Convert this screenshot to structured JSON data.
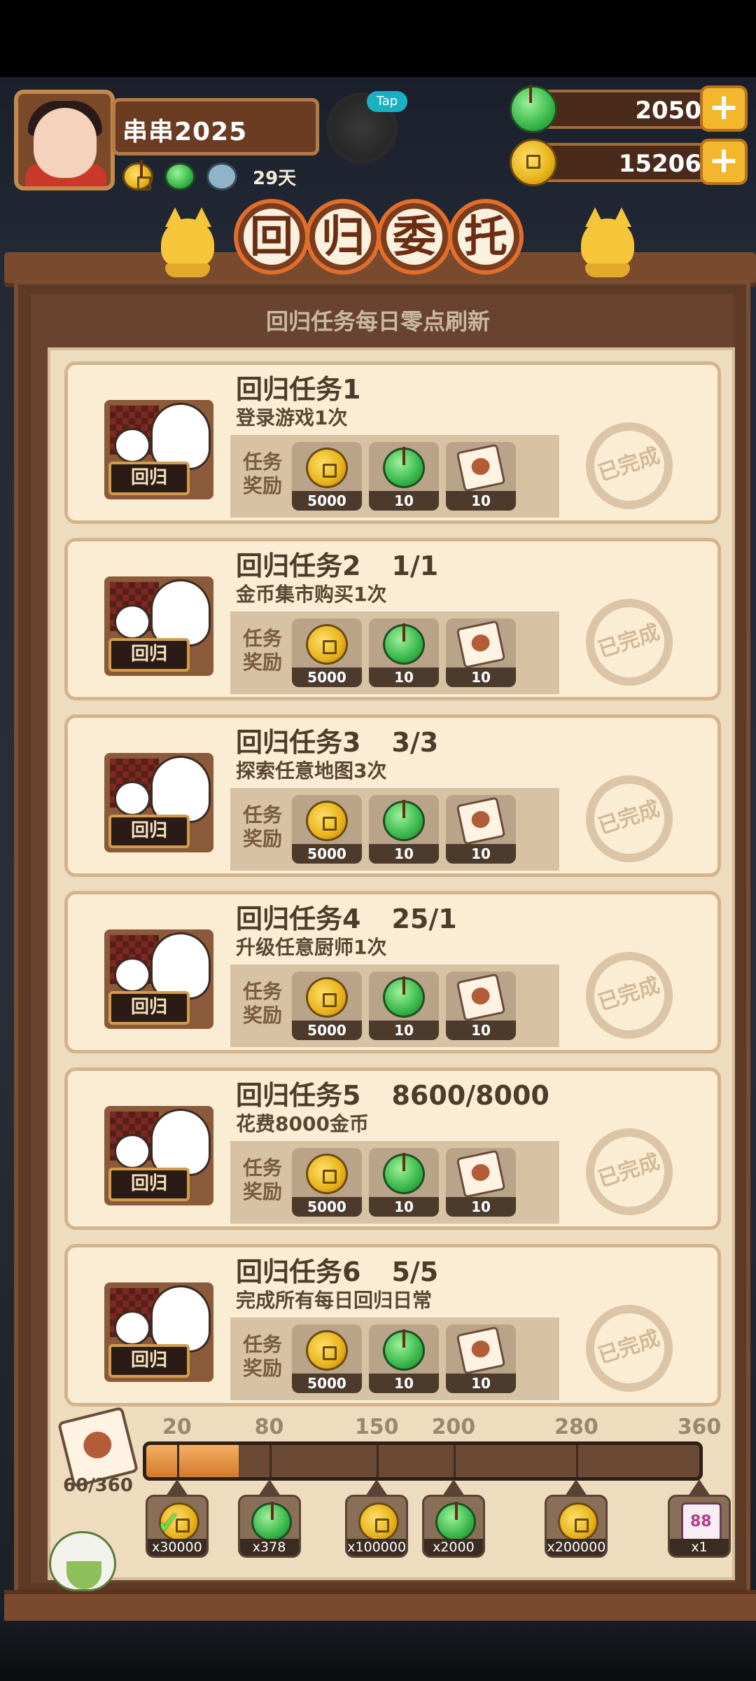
{
  "player": {
    "name": "串串2025",
    "days": "29天",
    "bonus_icons": [
      "coin-boost-icon",
      "jade-boost-icon",
      "bowl-boost-icon"
    ],
    "pet_badge": "Tap"
  },
  "currency": {
    "jade": {
      "value": "2050",
      "icon": "jade-icon"
    },
    "coin": {
      "value": "15206",
      "icon": "coin-icon"
    },
    "plus": "+"
  },
  "title": [
    "回",
    "归",
    "委",
    "托"
  ],
  "refresh_notice": "回归任务每日零点刷新",
  "reward_label": "任务\n奖励",
  "stamp_text": "已完成",
  "sign_text": "回归",
  "tasks": [
    {
      "title": "回归任务1",
      "progress": "",
      "desc": "登录游戏1次",
      "rewards": [
        {
          "icon": "coin-icon",
          "count": "5000"
        },
        {
          "icon": "jade-icon",
          "count": "10"
        },
        {
          "icon": "recipe-scroll-icon",
          "count": "10"
        }
      ]
    },
    {
      "title": "回归任务2",
      "progress": "1/1",
      "desc": "金币集市购买1次",
      "rewards": [
        {
          "icon": "coin-icon",
          "count": "5000"
        },
        {
          "icon": "jade-icon",
          "count": "10"
        },
        {
          "icon": "recipe-scroll-icon",
          "count": "10"
        }
      ]
    },
    {
      "title": "回归任务3",
      "progress": "3/3",
      "desc": "探索任意地图3次",
      "rewards": [
        {
          "icon": "coin-icon",
          "count": "5000"
        },
        {
          "icon": "jade-icon",
          "count": "10"
        },
        {
          "icon": "recipe-scroll-icon",
          "count": "10"
        }
      ]
    },
    {
      "title": "回归任务4",
      "progress": "25/1",
      "desc": "升级任意厨师1次",
      "rewards": [
        {
          "icon": "coin-icon",
          "count": "5000"
        },
        {
          "icon": "jade-icon",
          "count": "10"
        },
        {
          "icon": "recipe-scroll-icon",
          "count": "10"
        }
      ]
    },
    {
      "title": "回归任务5",
      "progress": "8600/8000",
      "desc": "花费8000金币",
      "rewards": [
        {
          "icon": "coin-icon",
          "count": "5000"
        },
        {
          "icon": "jade-icon",
          "count": "10"
        },
        {
          "icon": "recipe-scroll-icon",
          "count": "10"
        }
      ]
    },
    {
      "title": "回归任务6",
      "progress": "5/5",
      "desc": "完成所有每日回归日常",
      "rewards": [
        {
          "icon": "coin-icon",
          "count": "5000"
        },
        {
          "icon": "jade-icon",
          "count": "10"
        },
        {
          "icon": "recipe-scroll-icon",
          "count": "10"
        }
      ]
    }
  ],
  "progress": {
    "current": 60,
    "max": 360,
    "count_text": "60/360",
    "icon": "recipe-scroll-icon",
    "milestones": [
      {
        "label": "20",
        "value": 20,
        "icon": "coin-icon",
        "count": "x30000",
        "claimed": true
      },
      {
        "label": "80",
        "value": 80,
        "icon": "jade-icon",
        "count": "x378",
        "claimed": false
      },
      {
        "label": "150",
        "value": 150,
        "icon": "coin-icon",
        "count": "x100000",
        "claimed": false
      },
      {
        "label": "200",
        "value": 200,
        "icon": "jade-icon",
        "count": "x2000",
        "claimed": false
      },
      {
        "label": "280",
        "value": 280,
        "icon": "coin-icon",
        "count": "x200000",
        "claimed": false
      },
      {
        "label": "360",
        "value": 360,
        "icon": "card-icon",
        "count": "x1",
        "claimed": false
      }
    ]
  },
  "colors": {
    "accent": "#f3b72e",
    "panel": "#5d3a25",
    "card": "#fbedd3",
    "fill": "#e0903c"
  }
}
